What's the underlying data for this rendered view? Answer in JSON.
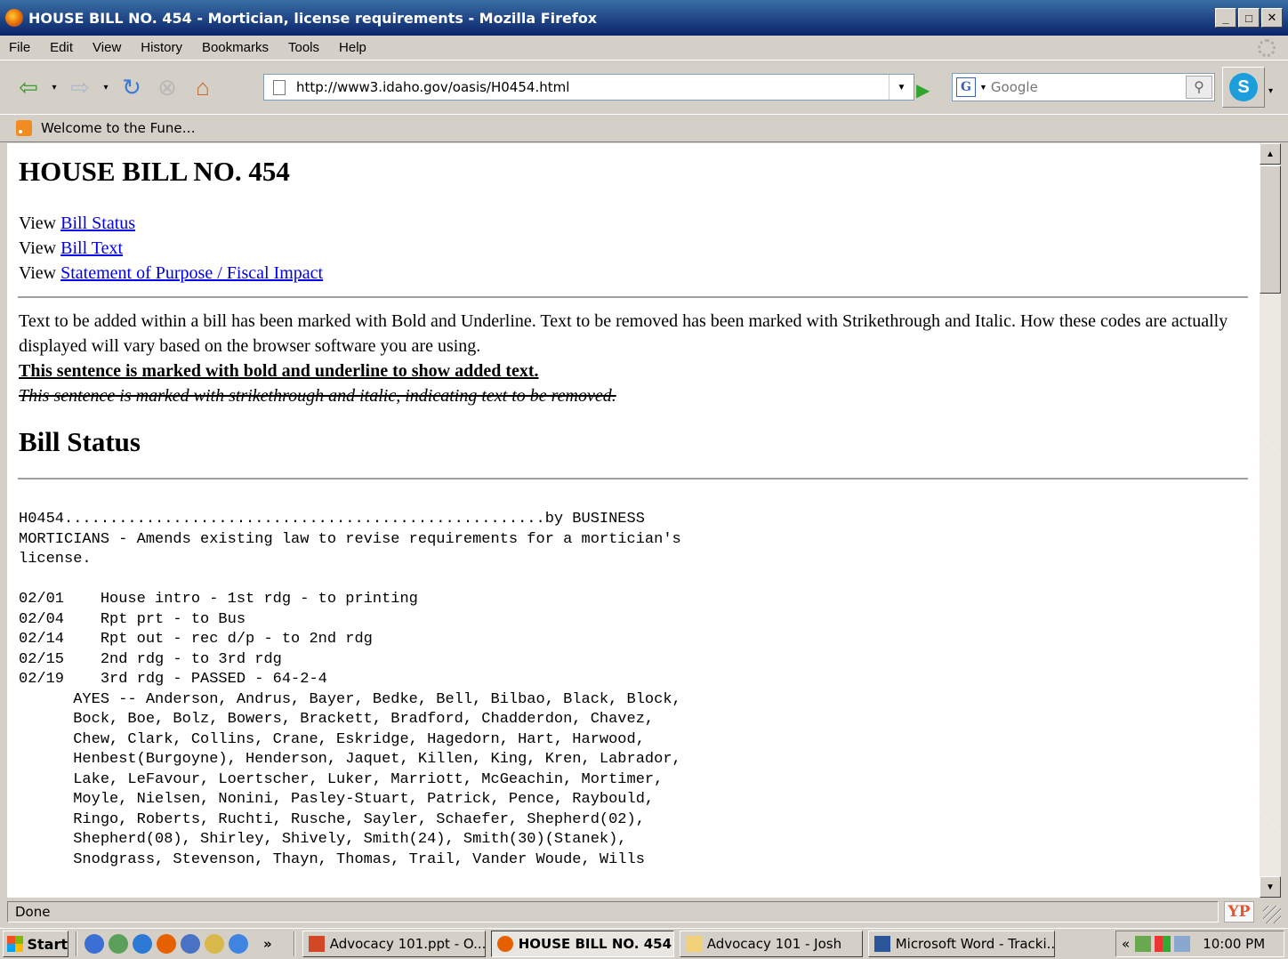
{
  "window": {
    "title": "HOUSE BILL NO. 454 - Mortician, license requirements - Mozilla Firefox",
    "minimize": "_",
    "maximize": "□",
    "close": "✕"
  },
  "menu": [
    "File",
    "Edit",
    "View",
    "History",
    "Bookmarks",
    "Tools",
    "Help"
  ],
  "toolbar": {
    "url": "http://www3.idaho.gov/oasis/H0454.html",
    "search_placeholder": "Google",
    "search_engine": "G"
  },
  "bookmarks": [
    {
      "label": "Welcome to the Fune…",
      "icon": "rss-icon"
    }
  ],
  "page": {
    "title": "HOUSE BILL NO. 454",
    "view_links": [
      {
        "prefix": "View",
        "label": "Bill Status "
      },
      {
        "prefix": "View",
        "label": "Bill Text "
      },
      {
        "prefix": "View",
        "label": "Statement of Purpose / Fiscal Impact "
      }
    ],
    "legend_text": "Text to be added within a bill has been marked with Bold and Underline. Text to be removed has been marked with Strikethrough and Italic. How these codes are actually displayed will vary based on the browser software you are using.",
    "added_example": "This sentence is marked with bold and underline to show added text.",
    "removed_example": "This sentence is marked with strikethrough and italic, indicating text to be removed.",
    "status_heading": "Bill Status",
    "status_lines": [
      "H0454.....................................................by BUSINESS",
      "MORTICIANS - Amends existing law to revise requirements for a mortician's",
      "license.",
      "",
      "02/01    House intro - 1st rdg - to printing",
      "02/04    Rpt prt - to Bus",
      "02/14    Rpt out - rec d/p - to 2nd rdg",
      "02/15    2nd rdg - to 3rd rdg",
      "02/19    3rd rdg - PASSED - 64-2-4",
      "      AYES -- Anderson, Andrus, Bayer, Bedke, Bell, Bilbao, Black, Block,",
      "      Bock, Boe, Bolz, Bowers, Brackett, Bradford, Chadderdon, Chavez,",
      "      Chew, Clark, Collins, Crane, Eskridge, Hagedorn, Hart, Harwood,",
      "      Henbest(Burgoyne), Henderson, Jaquet, Killen, King, Kren, Labrador,",
      "      Lake, LeFavour, Loertscher, Luker, Marriott, McGeachin, Mortimer,",
      "      Moyle, Nielsen, Nonini, Pasley-Stuart, Patrick, Pence, Raybould,",
      "      Ringo, Roberts, Ruchti, Rusche, Sayler, Schaefer, Shepherd(02),",
      "      Shepherd(08), Shirley, Shively, Smith(24), Smith(30)(Stanek),",
      "      Snodgrass, Stevenson, Thayn, Thomas, Trail, Vander Woude, Wills"
    ]
  },
  "statusbar": {
    "text": "Done",
    "yp_label": "YP"
  },
  "taskbar": {
    "start": "Start",
    "chevron": "»",
    "tasks": [
      {
        "label": "Advocacy 101.ppt - O...",
        "active": false,
        "width": 206
      },
      {
        "label": "HOUSE BILL NO. 454 ...",
        "active": true,
        "width": 206
      },
      {
        "label": "Advocacy 101 - Josh",
        "active": false,
        "width": 206
      },
      {
        "label": "Microsoft Word - Tracki...",
        "active": false,
        "width": 210
      }
    ],
    "tray_chevron": "«",
    "clock": "10:00 PM"
  },
  "colors": {
    "link": "#0000ee",
    "titlebar": "#0a246a",
    "chrome": "#d4d0c8"
  }
}
